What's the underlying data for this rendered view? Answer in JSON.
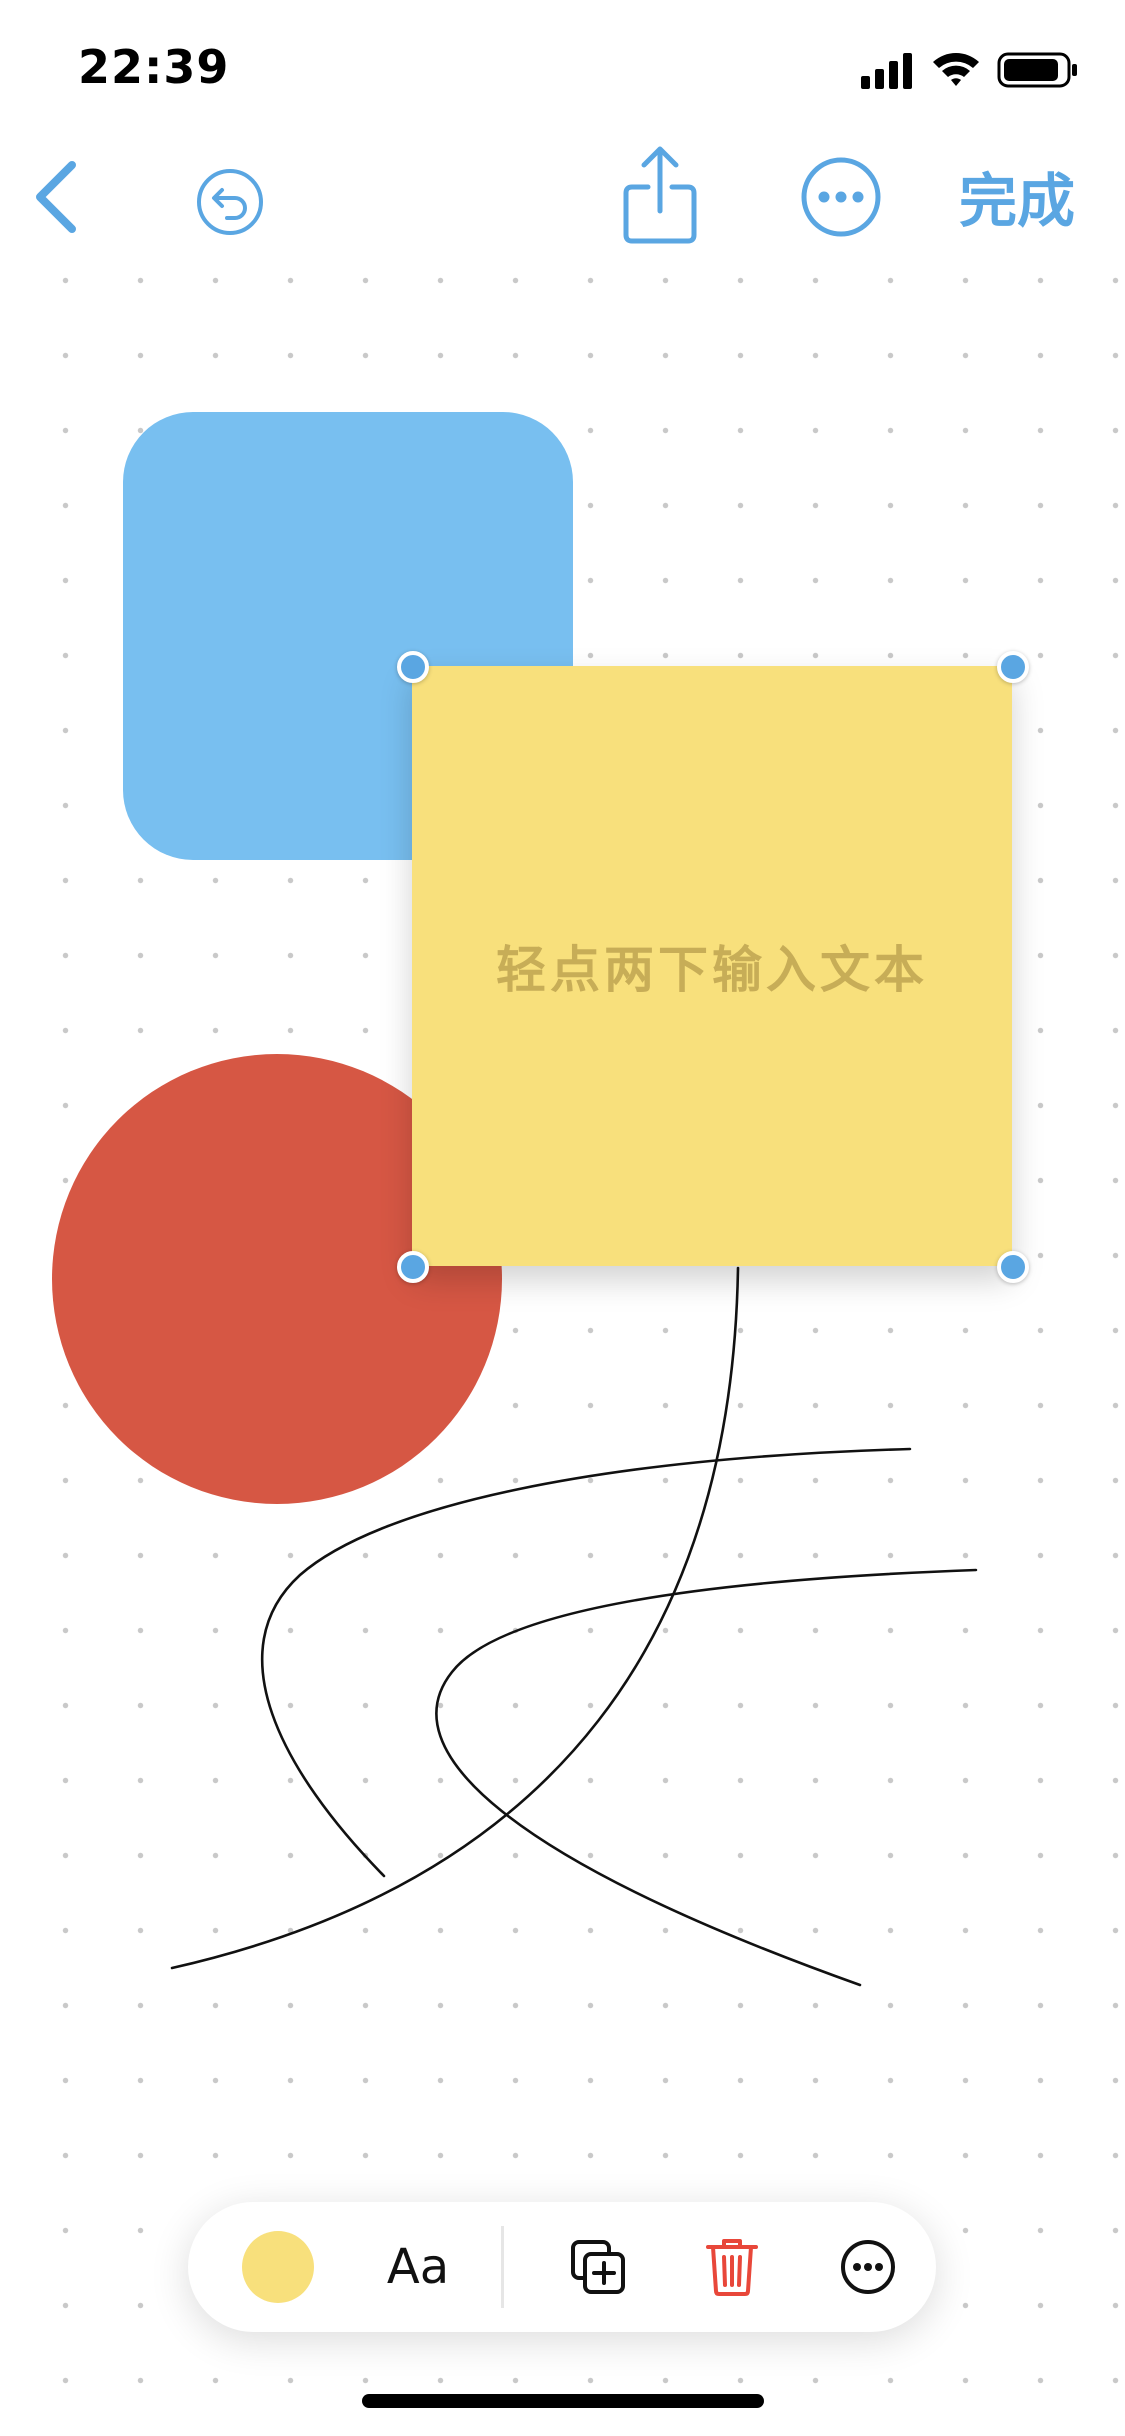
{
  "status_bar": {
    "time": "22:39"
  },
  "nav": {
    "back_icon": "chevron-left-icon",
    "undo_icon": "undo-circle-icon",
    "share_icon": "share-icon",
    "more_icon": "ellipsis-circle-icon",
    "done_label": "完成",
    "accent_color": "#5aa6e2"
  },
  "canvas": {
    "background": "dotted-grid",
    "shapes": [
      {
        "kind": "rounded-rectangle",
        "color": "#78bff0"
      },
      {
        "kind": "circle",
        "color": "#d65744"
      },
      {
        "kind": "sticky-note",
        "color": "#f8e07c",
        "selected": true
      }
    ],
    "sticky_placeholder": "轻点两下输入文本"
  },
  "toolbar": {
    "fill_color": "#f8e07c",
    "font_label": "Aa",
    "duplicate_icon": "duplicate-plus-icon",
    "delete_icon": "trash-icon",
    "delete_color": "#e8473a",
    "more_icon": "ellipsis-circle-icon"
  }
}
